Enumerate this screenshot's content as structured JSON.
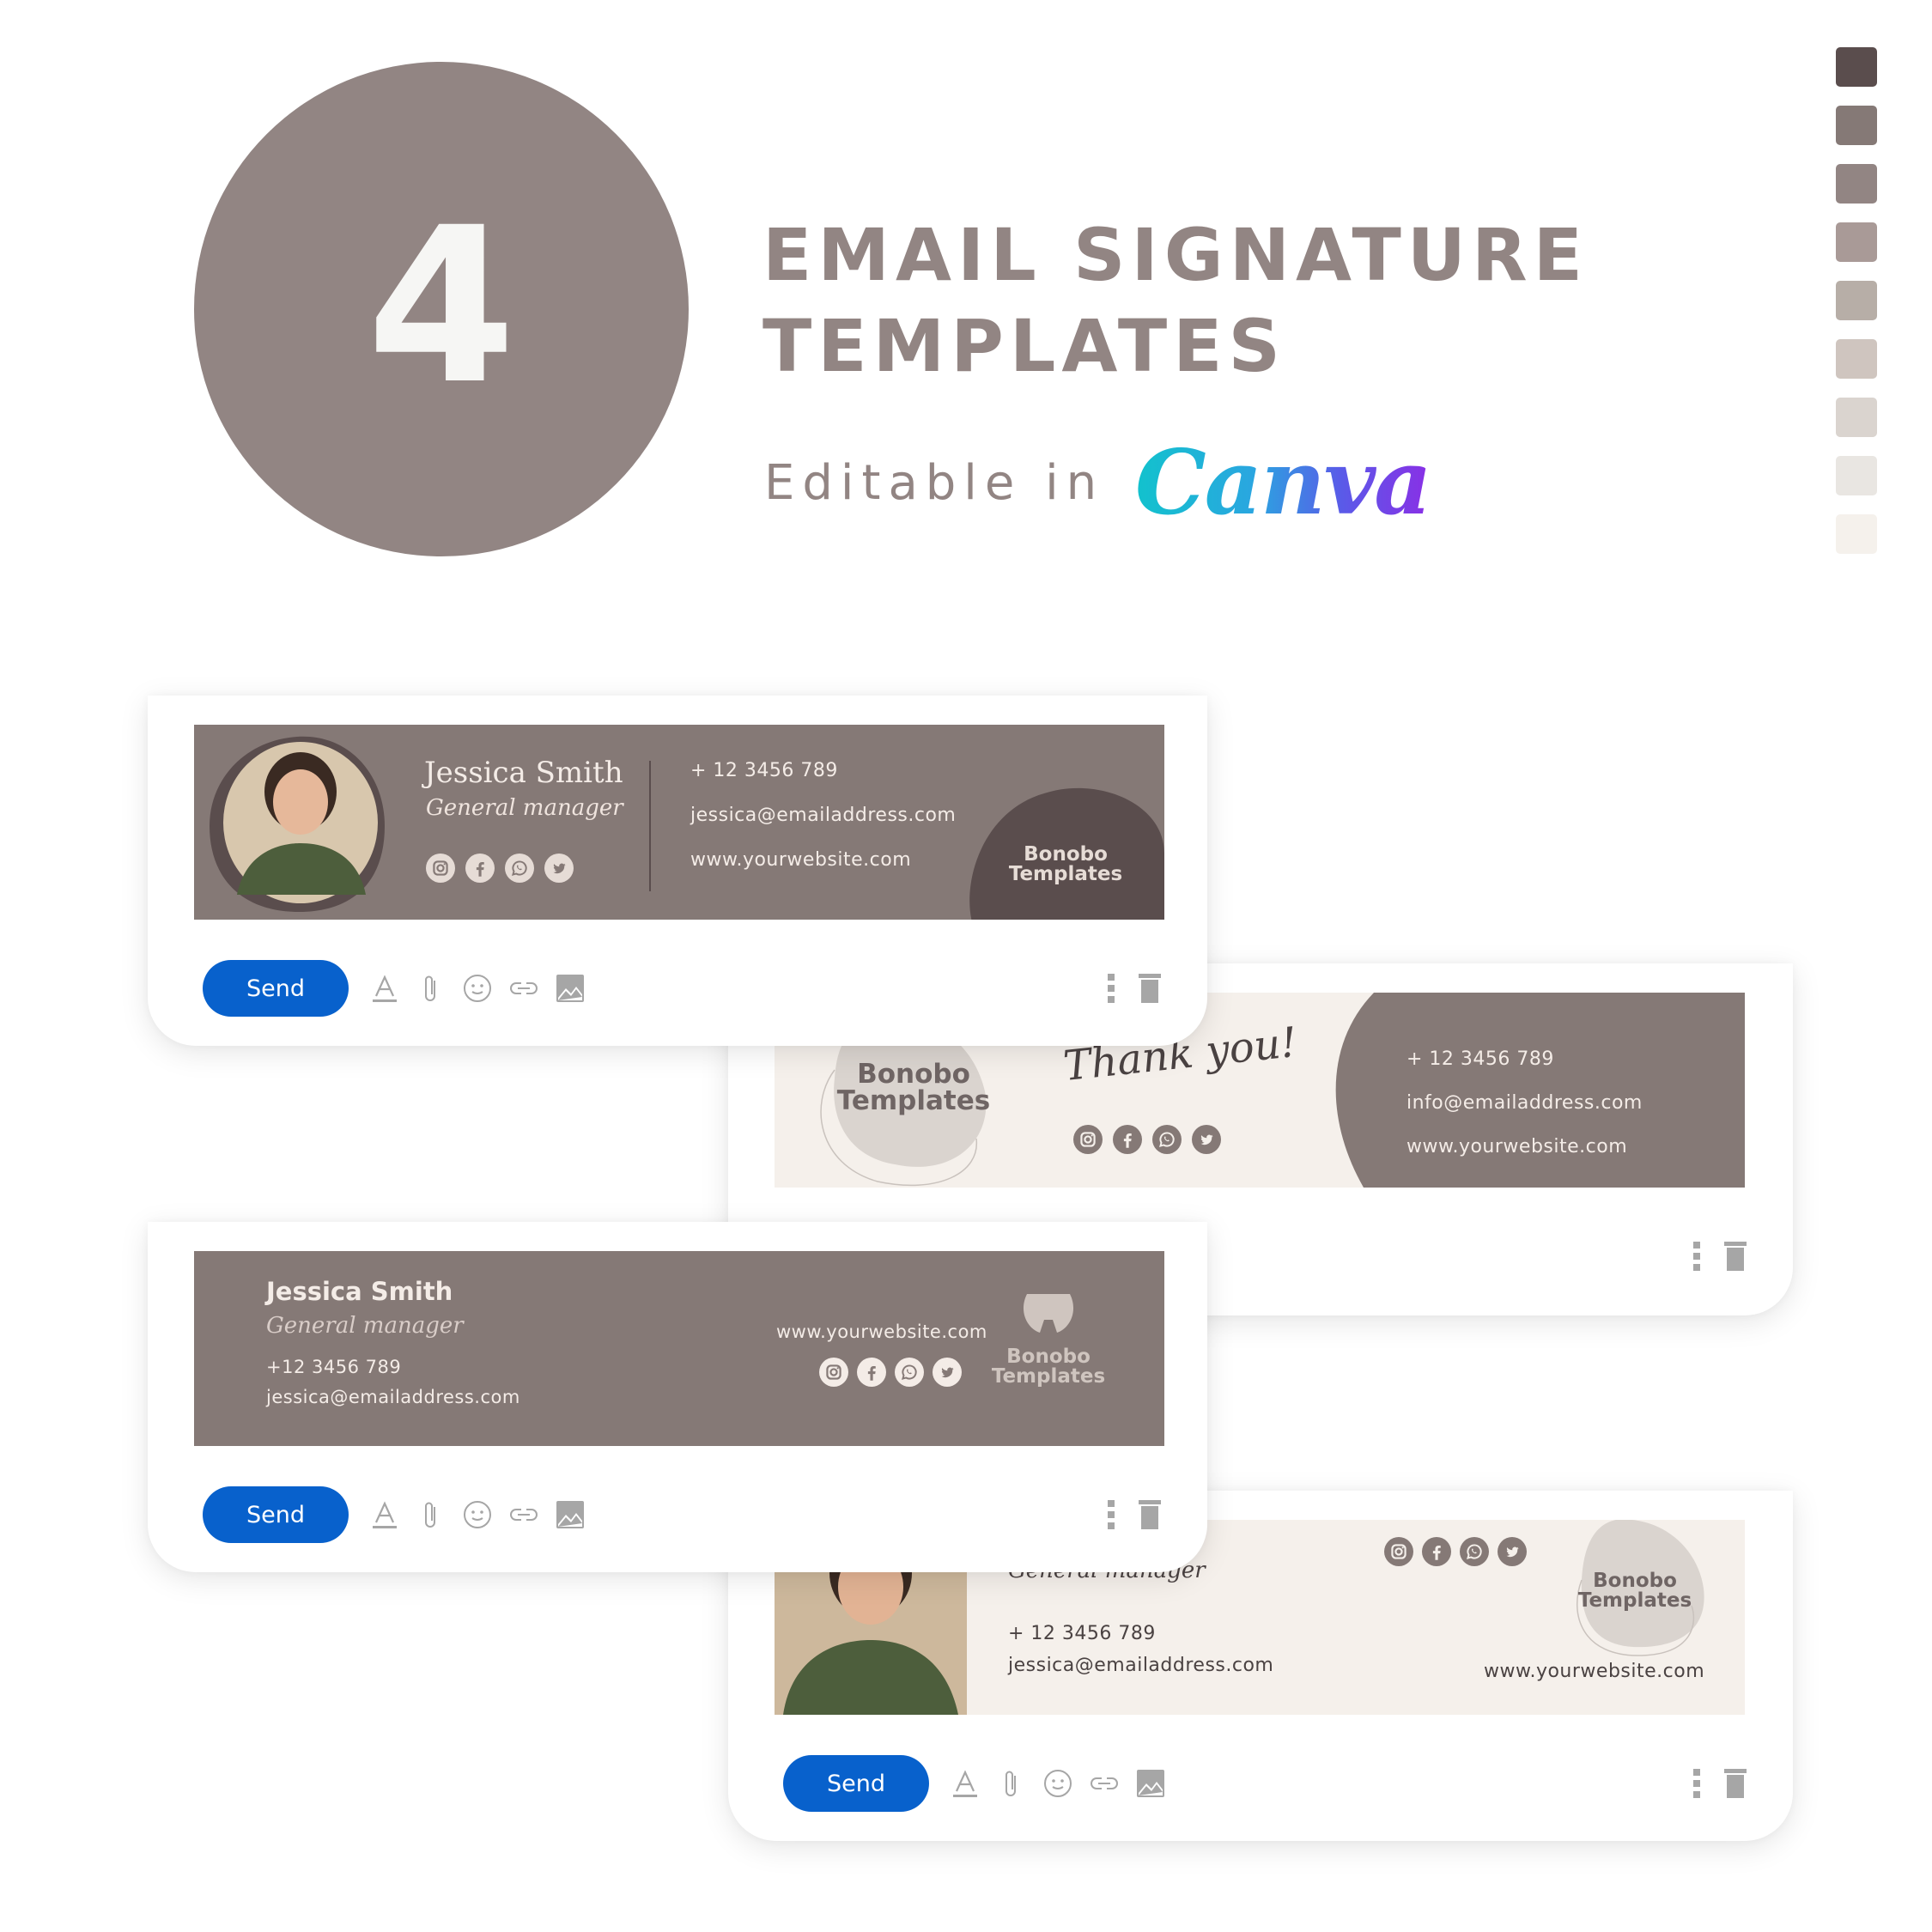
{
  "header": {
    "count": "4",
    "title_line1": "EMAIL SIGNATURE",
    "title_line2": "TEMPLATES",
    "editable_label": "Editable in",
    "canva_logo": "Canva"
  },
  "palette": [
    "#5a4d4d",
    "#857976",
    "#928583",
    "#a99a97",
    "#b7aea7",
    "#cfc5bf",
    "#dad4cf",
    "#e9e6e2",
    "#f5f1ec"
  ],
  "colors": {
    "accent_send": "#0861cc",
    "banner_dark": "#857976",
    "banner_light": "#f5f0eb",
    "blob": "#dad4cf"
  },
  "toolbar": {
    "send_label": "Send",
    "icons": [
      "text-format-icon",
      "paperclip-icon",
      "emoji-icon",
      "link-icon",
      "image-icon"
    ],
    "right_icons": [
      "more-vertical-icon",
      "trash-icon"
    ]
  },
  "social_icons": [
    "instagram-icon",
    "facebook-icon",
    "whatsapp-icon",
    "twitter-icon"
  ],
  "cards": [
    {
      "name": "Jessica Smith",
      "role": "General manager",
      "phone": "+ 12 3456 789",
      "email": "jessica@emailaddress.com",
      "website": "www.yourwebsite.com",
      "brand_line1": "Bonobo",
      "brand_line2": "Templates"
    },
    {
      "greeting": "Thank you!",
      "phone": "+ 12 3456 789",
      "email": "info@emailaddress.com",
      "website": "www.yourwebsite.com",
      "brand_line1": "Bonobo",
      "brand_line2": "Templates"
    },
    {
      "name": "Jessica Smith",
      "role": "General manager",
      "phone": "+12 3456 789",
      "email": "jessica@emailaddress.com",
      "website": "www.yourwebsite.com",
      "brand_line1": "Bonobo",
      "brand_line2": "Templates"
    },
    {
      "role": "General manager",
      "phone": "+ 12 3456 789",
      "email": "jessica@emailaddress.com",
      "website": "www.yourwebsite.com",
      "brand_line1": "Bonobo",
      "brand_line2": "Templates"
    }
  ]
}
